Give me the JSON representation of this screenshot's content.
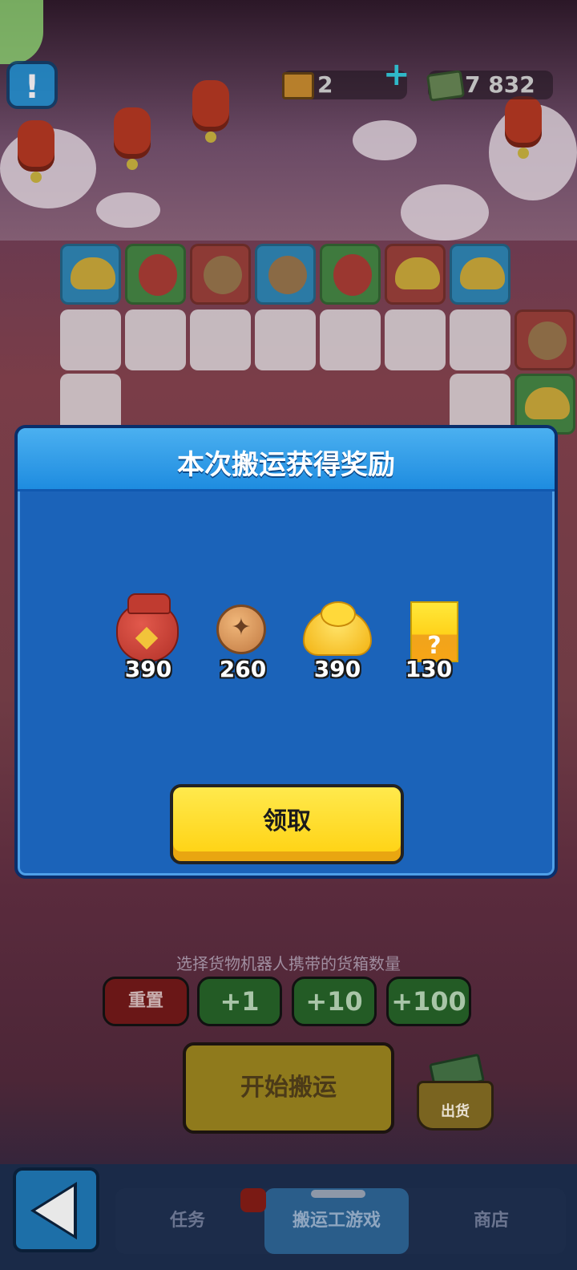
{
  "header": {
    "crates_count": "2",
    "cash_amount": "7 832"
  },
  "reward_dialog": {
    "title": "本次搬运获得奖励",
    "rewards": [
      {
        "icon": "lucky-bag-icon",
        "amount": "390"
      },
      {
        "icon": "copper-coin-icon",
        "amount": "260"
      },
      {
        "icon": "gold-ingot-icon",
        "amount": "390"
      },
      {
        "icon": "mystery-box-icon",
        "amount": "130"
      }
    ],
    "claim_label": "领取"
  },
  "controls": {
    "hint": "选择货物机器人携带的货箱数量",
    "reset_label": "重置",
    "plus1_label": "+1",
    "plus10_label": "+10",
    "plus100_label": "+100",
    "start_label": "开始搬运",
    "ship_label": "出货"
  },
  "nav": {
    "tabs": [
      {
        "label": "任务"
      },
      {
        "label": "搬运工游戏"
      },
      {
        "label": "商店"
      }
    ]
  }
}
